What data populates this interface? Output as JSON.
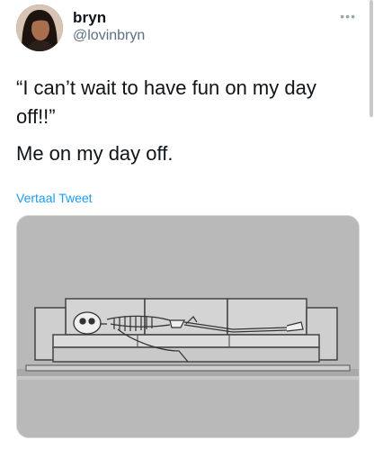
{
  "author": {
    "display_name": "bryn",
    "handle": "@lovinbryn"
  },
  "tweet": {
    "text_line1": "“I can’t wait to have fun on my day\noff!!”",
    "text_line2": "Me on my day off.",
    "translate_label": "Vertaal Tweet"
  },
  "icons": {
    "more": "more-icon",
    "avatar": "avatar",
    "media": "skeleton-on-couch-image"
  },
  "colors": {
    "link": "#1d9bf0",
    "handle": "#5b7083",
    "text": "#0f1419"
  }
}
